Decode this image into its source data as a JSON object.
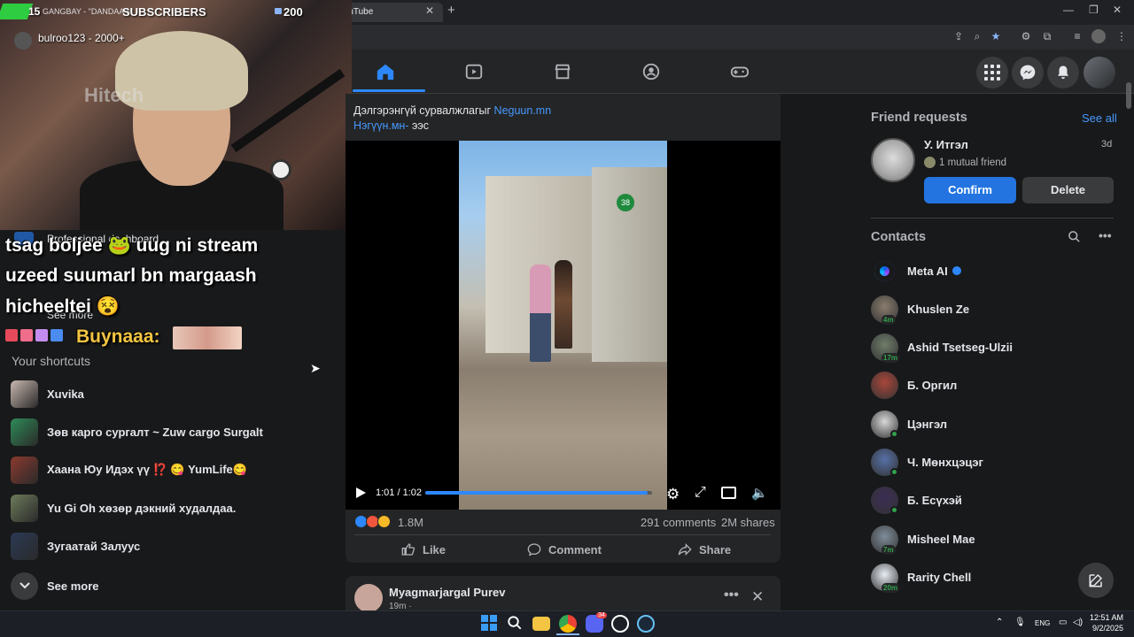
{
  "browser": {
    "tab_title": "YouTube",
    "window_controls": [
      "—",
      "❐",
      "✕"
    ]
  },
  "overlay": {
    "sub_count": "15",
    "sub_text": "GANGBAY - \"DANDAA H",
    "subscribers_label": "SUBSCRIBERS",
    "right_count": "200",
    "username": "bulroo123 - 2000+",
    "camera_brand": "Hitech"
  },
  "chat": {
    "line1": "tsag boljee 🐸 uug ni stream",
    "line2": "uzeed suumarl bn margaash",
    "line3": "hicheeltei 😵",
    "line4_user": "Buynaaa:"
  },
  "leftnav": {
    "professional_dashboard": "Professional dashboard",
    "see_more_top": "See more",
    "shortcuts_title": "Your shortcuts",
    "shortcuts": [
      {
        "label": "Xuvika",
        "color": "#c9b8b0"
      },
      {
        "label": "Зөв карго сургалт ~ Zuw cargo Surgalt",
        "color": "#2e8b57"
      },
      {
        "label": "Хаана Юу Идэх үү ⁉️ 😋 YumLife😋",
        "color": "#8b3a2e"
      },
      {
        "label": "Yu Gi Oh хөзөр дэкний худалдаа.",
        "color": "#6d7b5a"
      },
      {
        "label": "Зугаатай Залуус",
        "color": "#2b3a55"
      }
    ],
    "see_more_bottom": "See more"
  },
  "post": {
    "line1_prefix": "Дэлгэрэнгүй сурвалжлагыг ",
    "line1_link": "Neguun.mn",
    "line2_link": "Нэгүүн.мн-",
    "line2_suffix": " ээс",
    "video_badge": "38",
    "video_time": "1:01 / 1:02",
    "progress": 0.98,
    "reactions_count": "1.8M",
    "comments": "291 comments",
    "shares": "2M shares",
    "like_label": "Like",
    "comment_label": "Comment",
    "share_label": "Share"
  },
  "post2": {
    "author": "Myagmarjargal Purev",
    "time": "19m ·"
  },
  "friend_requests": {
    "title": "Friend requests",
    "see_all": "See all",
    "name": "У. Итгэл",
    "age": "3d",
    "mutual": "1 mutual friend",
    "confirm": "Confirm",
    "delete": "Delete"
  },
  "contacts": {
    "title": "Contacts",
    "list": [
      {
        "name": "Meta AI",
        "badge": "",
        "online": false,
        "color": "#7b3fe4"
      },
      {
        "name": "Khuslen Ze",
        "badge": "4m",
        "online": false,
        "color": "#8a7d6e"
      },
      {
        "name": "Ashid Tsetseg-Ulzii",
        "badge": "17m",
        "online": false,
        "color": "#6f7d6a"
      },
      {
        "name": "Б. Оргил",
        "badge": "",
        "online": false,
        "color": "#a8463a"
      },
      {
        "name": "Цэнгэл",
        "badge": "",
        "online": true,
        "color": "#d8d8d8"
      },
      {
        "name": "Ч. Мөнхцэцэг",
        "badge": "",
        "online": true,
        "color": "#5670a6"
      },
      {
        "name": "Б. Есүхэй",
        "badge": "",
        "online": true,
        "color": "#3b2d55"
      },
      {
        "name": "Misheel Mae",
        "badge": "7m",
        "online": false,
        "color": "#7f8d9a"
      },
      {
        "name": "Rarity Chell",
        "badge": "20m",
        "online": false,
        "color": "#e8eef5"
      }
    ]
  },
  "taskbar": {
    "lang": "ENG",
    "time": "12:51 AM",
    "date": "9/2/2025",
    "discord_badge": "34"
  }
}
